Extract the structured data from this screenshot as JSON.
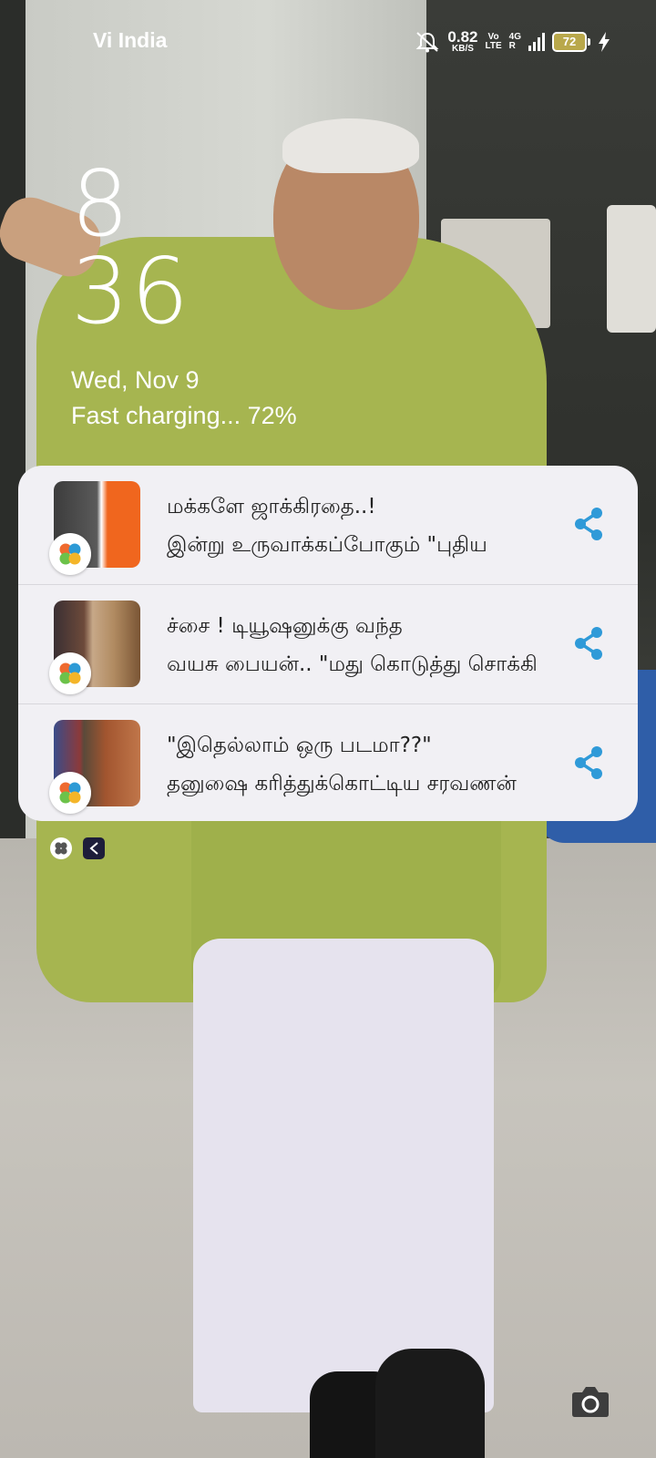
{
  "status_bar": {
    "carrier": "Vi India",
    "net_speed_value": "0.82",
    "net_speed_unit": "KB/S",
    "volte_top": "Vo",
    "volte_bottom": "LTE",
    "network_type": "4G",
    "network_sub": "R",
    "battery_level": "72",
    "icons": [
      "mute-icon",
      "signal-icon",
      "battery-icon",
      "charging-bolt-icon"
    ]
  },
  "lockscreen": {
    "hour": "8",
    "minute": "36",
    "date": "Wed, Nov 9",
    "charging_status": "Fast charging... 72%"
  },
  "notifications": [
    {
      "line1": "மக்களே ஜாக்கிரதை..!",
      "line2": "இன்று உருவாக்கப்போகும் \"புதிய",
      "thumb_colors": [
        "#3c3c3c",
        "#f0661e"
      ]
    },
    {
      "line1": "ச்சை ! டியூஷனுக்கு வந்த",
      "line2": "வயசு பையன்.. \"மது கொடுத்து சொக்கி",
      "thumb_colors": [
        "#6d4a3a",
        "#b08a60"
      ]
    },
    {
      "line1": "\"இதெல்லாம் ஒரு படமா??\"",
      "line2": "தனுஷை கரித்துக்கொட்டிய சரவணன்",
      "thumb_colors": [
        "#3a4c8a",
        "#a2552f"
      ]
    }
  ],
  "colors": {
    "share_icon": "#2f9ad8",
    "card_bg": "#f1f0f4",
    "battery_fill": "#b9a84b"
  }
}
